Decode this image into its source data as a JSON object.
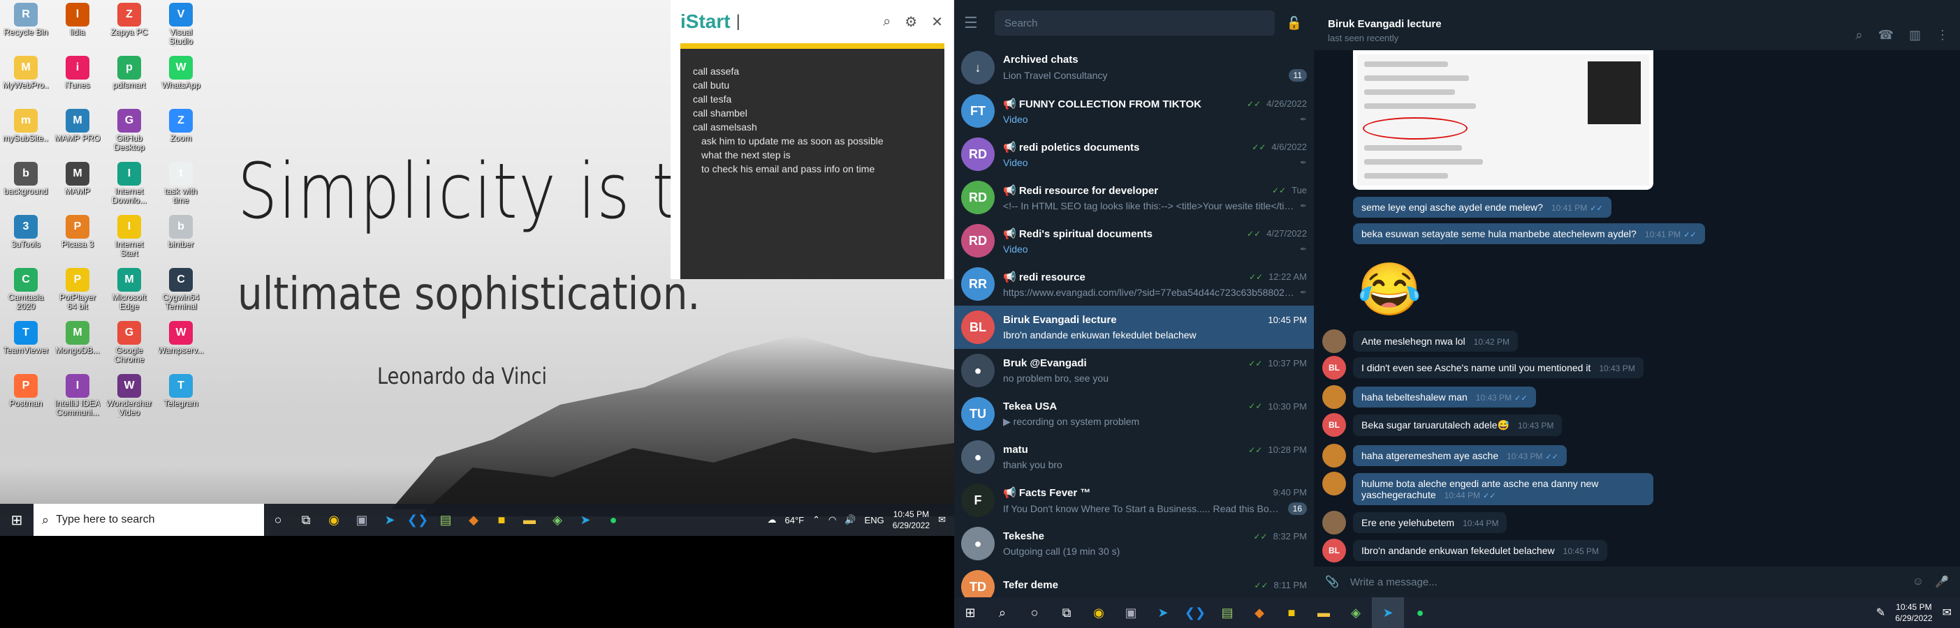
{
  "left_screen": {
    "desktop_icons": [
      {
        "label": "Recycle Bin",
        "icon": "recycle-bin-icon",
        "color": "#7aa6c8"
      },
      {
        "label": "lidia",
        "icon": "app-icon",
        "color": "#d35400"
      },
      {
        "label": "Zapya PC",
        "icon": "zapya-icon",
        "color": "#e74c3c"
      },
      {
        "label": "Visual Studio Code",
        "icon": "vscode-icon",
        "color": "#1e88e5"
      },
      {
        "label": "MyWebPro...",
        "icon": "folder-icon",
        "color": "#f4c542"
      },
      {
        "label": "iTunes",
        "icon": "itunes-icon",
        "color": "#e91e63"
      },
      {
        "label": "pdfsmart",
        "icon": "pdf-icon",
        "color": "#27ae60"
      },
      {
        "label": "WhatsApp",
        "icon": "whatsapp-icon",
        "color": "#25d366"
      },
      {
        "label": "mySubSite...",
        "icon": "folder-icon",
        "color": "#f4c542"
      },
      {
        "label": "MAMP PRO",
        "icon": "mamp-icon",
        "color": "#2980b9"
      },
      {
        "label": "GitHub Desktop",
        "icon": "github-icon",
        "color": "#8e44ad"
      },
      {
        "label": "Zoom",
        "icon": "zoom-icon",
        "color": "#2d8cff"
      },
      {
        "label": "background",
        "icon": "image-file-icon",
        "color": "#555555"
      },
      {
        "label": "MAMP",
        "icon": "mamp-icon",
        "color": "#444444"
      },
      {
        "label": "Internet Downlo...",
        "icon": "idm-icon",
        "color": "#16a085"
      },
      {
        "label": "task with time",
        "icon": "text-file-icon",
        "color": "#ecf0f1"
      },
      {
        "label": "3uTools",
        "icon": "3utools-icon",
        "color": "#2980b9"
      },
      {
        "label": "Picasa 3",
        "icon": "picasa-icon",
        "color": "#e67e22"
      },
      {
        "label": "Internet Start",
        "icon": "chrome-icon",
        "color": "#f1c40f"
      },
      {
        "label": "bintber",
        "icon": "file-icon",
        "color": "#bdc3c7"
      },
      {
        "label": "Camtasia 2020",
        "icon": "camtasia-icon",
        "color": "#27ae60"
      },
      {
        "label": "PotPlayer 64 bit",
        "icon": "potplayer-icon",
        "color": "#f1c40f"
      },
      {
        "label": "Microsoft Edge",
        "icon": "edge-icon",
        "color": "#16a085"
      },
      {
        "label": "Cygwin64 Terminal",
        "icon": "terminal-icon",
        "color": "#2c3e50"
      },
      {
        "label": "TeamViewer",
        "icon": "teamviewer-icon",
        "color": "#0e8ee9"
      },
      {
        "label": "MongoDB...",
        "icon": "mongodb-icon",
        "color": "#4caf50"
      },
      {
        "label": "Google Chrome",
        "icon": "chrome-icon",
        "color": "#e74c3c"
      },
      {
        "label": "Wampserv...",
        "icon": "wamp-icon",
        "color": "#e91e63"
      },
      {
        "label": "Postman",
        "icon": "postman-icon",
        "color": "#ff6c37"
      },
      {
        "label": "IntelliJ IDEA Communi...",
        "icon": "intellij-icon",
        "color": "#8e44ad"
      },
      {
        "label": "Wondershare Video Conv...",
        "icon": "video-icon",
        "color": "#6c3483"
      },
      {
        "label": "Telegram",
        "icon": "telegram-icon",
        "color": "#2aa3e0"
      }
    ],
    "wallpaper": {
      "line1": "Simplicity is th",
      "line2": "ultimate sophistication.",
      "line3": "Leonardo da Vinci"
    },
    "istart": {
      "brand": "iStart",
      "cursor": "|",
      "note_lines": [
        {
          "text": "call assefa",
          "indent": false
        },
        {
          "text": "call butu",
          "indent": false
        },
        {
          "text": "call tesfa",
          "indent": false
        },
        {
          "text": "call shambel",
          "indent": false
        },
        {
          "text": "call asmelsash",
          "indent": false
        },
        {
          "text": "ask him to update me as soon as possible",
          "indent": true
        },
        {
          "text": "what the next step is",
          "indent": true
        },
        {
          "text": "to check his email and pass info on time",
          "indent": true
        }
      ]
    },
    "taskbar": {
      "search_placeholder": "Type here to search",
      "weather": "64°F",
      "lang": "ENG",
      "time": "10:45 PM",
      "date": "6/29/2022"
    }
  },
  "telegram": {
    "search_placeholder": "Search",
    "chats": [
      {
        "name": "Archived chats",
        "preview": "Lion Travel Consultancy",
        "time": "",
        "initials": "",
        "avatar_color": "#3e546a",
        "badge": "11",
        "check": "",
        "preview_hl": false,
        "pinned": false,
        "channel": false,
        "active": false
      },
      {
        "name": "FUNNY COLLECTION FROM TIKTOK",
        "preview": "Video",
        "time": "4/26/2022",
        "initials": "FT",
        "avatar_color": "#3f8fd4",
        "badge": "",
        "check": "✓✓",
        "preview_hl": true,
        "pinned": true,
        "channel": true,
        "active": false
      },
      {
        "name": "redi poletics documents",
        "preview": "Video",
        "time": "4/6/2022",
        "initials": "RD",
        "avatar_color": "#8a5fc8",
        "badge": "",
        "check": "✓✓",
        "preview_hl": true,
        "pinned": true,
        "channel": true,
        "active": false
      },
      {
        "name": "Redi resource for developer",
        "preview": "<!-- In HTML SEO tag looks like this:--> <title>Your wesite title</title> ...",
        "time": "Tue",
        "initials": "RD",
        "avatar_color": "#4fae4e",
        "badge": "",
        "check": "✓✓",
        "preview_hl": false,
        "pinned": true,
        "channel": true,
        "active": false
      },
      {
        "name": "Redi's spiritual documents",
        "preview": "Video",
        "time": "4/27/2022",
        "initials": "RD",
        "avatar_color": "#c44f7e",
        "badge": "",
        "check": "✓✓",
        "preview_hl": true,
        "pinned": true,
        "channel": true,
        "active": false
      },
      {
        "name": "redi resource",
        "preview": "https://www.evangadi.com/live/?sid=77eba54d44c723c63b5880267...",
        "time": "12:22 AM",
        "initials": "RR",
        "avatar_color": "#3f8fd4",
        "badge": "",
        "check": "✓✓",
        "preview_hl": false,
        "pinned": true,
        "channel": true,
        "active": false
      },
      {
        "name": "Biruk Evangadi lecture",
        "preview": "Ibro'n andande enkuwan fekedulet belachew",
        "time": "10:45 PM",
        "initials": "BL",
        "avatar_color": "#e05151",
        "badge": "",
        "check": "",
        "preview_hl": false,
        "pinned": false,
        "channel": false,
        "active": true
      },
      {
        "name": "Bruk @Evangadi",
        "preview": "no problem bro, see you",
        "time": "10:37 PM",
        "initials": "",
        "avatar_color": "#3b4a5a",
        "badge": "",
        "check": "✓✓",
        "preview_hl": false,
        "pinned": false,
        "channel": false,
        "active": false
      },
      {
        "name": "Tekea USA",
        "preview": "▶ recording on  system problem",
        "time": "10:30 PM",
        "initials": "TU",
        "avatar_color": "#3f8fd4",
        "badge": "",
        "check": "✓✓",
        "preview_hl": false,
        "pinned": false,
        "channel": false,
        "active": false
      },
      {
        "name": "matu",
        "preview": "thank you bro",
        "time": "10:28 PM",
        "initials": "",
        "avatar_color": "#4a5d70",
        "badge": "",
        "check": "✓✓",
        "preview_hl": false,
        "pinned": false,
        "channel": false,
        "active": false
      },
      {
        "name": "Facts Fever ™",
        "preview": "If You Don't know Where To Start a Business..... Read this Books ...",
        "time": "9:40 PM",
        "initials": "F",
        "avatar_color": "#1f2a24",
        "badge": "16",
        "check": "",
        "preview_hl": false,
        "pinned": false,
        "channel": true,
        "active": false
      },
      {
        "name": "Tekeshe",
        "preview": "Outgoing call (19 min 30 s)",
        "time": "8:32 PM",
        "initials": "",
        "avatar_color": "#7a8794",
        "badge": "",
        "check": "✓✓",
        "preview_hl": false,
        "pinned": false,
        "channel": false,
        "active": false
      },
      {
        "name": "Tefer deme",
        "preview": "",
        "time": "8:11 PM",
        "initials": "TD",
        "avatar_color": "#e8894a",
        "badge": "",
        "check": "✓✓",
        "preview_hl": false,
        "pinned": false,
        "channel": false,
        "active": false
      }
    ],
    "conversation": {
      "title": "Biruk Evangadi lecture",
      "status": "last seen recently",
      "messages": [
        {
          "dir": "out",
          "text": "seme leye engi asche aydel ende melew?",
          "time": "10:41 PM"
        },
        {
          "dir": "out",
          "text": "beka esuwan setayate seme hula manbebe atechelewm aydel?",
          "time": "10:41 PM"
        },
        {
          "dir": "emoji",
          "text": "😂",
          "time": ""
        },
        {
          "dir": "in",
          "text": "Ante meslehegn nwa lol",
          "time": "10:42 PM"
        },
        {
          "dir": "in",
          "text": "I didn't even see Asche's name until you mentioned it",
          "time": "10:43 PM"
        },
        {
          "dir": "out",
          "text": "haha tebelteshalew man",
          "time": "10:43 PM"
        },
        {
          "dir": "in",
          "text": "Beka sugar taruarutalech adele😅",
          "time": "10:43 PM"
        },
        {
          "dir": "out",
          "text": "haha atgeremeshem aye asche",
          "time": "10:43 PM"
        },
        {
          "dir": "out",
          "text": "hulume bota aleche engedi ante asche ena  danny new yaschegerachute",
          "time": "10:44 PM"
        },
        {
          "dir": "in",
          "text": "Ere ene yelehubetem",
          "time": "10:44 PM"
        },
        {
          "dir": "in",
          "text": "Ibro'n andande enkuwan fekedulet belachew",
          "time": "10:45 PM"
        }
      ],
      "composer_placeholder": "Write a message..."
    },
    "taskbar": {
      "time": "10:45 PM",
      "date": "6/29/2022"
    }
  }
}
